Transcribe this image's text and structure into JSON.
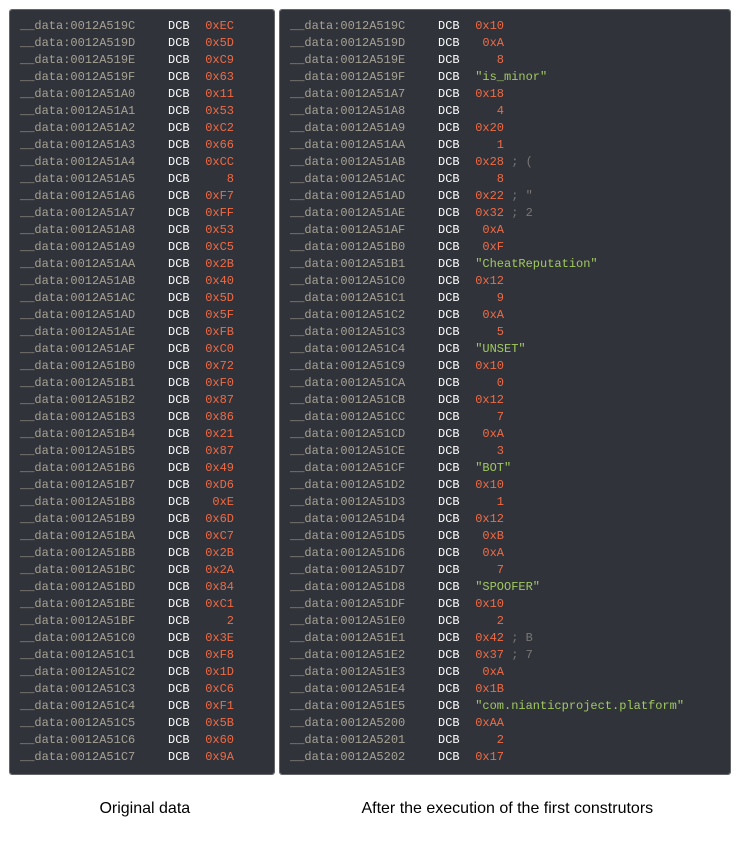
{
  "captions": {
    "left": "Original data",
    "right": "After the execution of the first construtors"
  },
  "dcb_keyword": "DCB",
  "prefix": "__data:",
  "left_rows": [
    {
      "a": "0012A519C",
      "v": "0xEC",
      "t": "hex"
    },
    {
      "a": "0012A519D",
      "v": "0x5D",
      "t": "hex"
    },
    {
      "a": "0012A519E",
      "v": "0xC9",
      "t": "hex"
    },
    {
      "a": "0012A519F",
      "v": "0x63",
      "t": "hex"
    },
    {
      "a": "0012A51A0",
      "v": "0x11",
      "t": "hex"
    },
    {
      "a": "0012A51A1",
      "v": "0x53",
      "t": "hex"
    },
    {
      "a": "0012A51A2",
      "v": "0xC2",
      "t": "hex"
    },
    {
      "a": "0012A51A3",
      "v": "0x66",
      "t": "hex"
    },
    {
      "a": "0012A51A4",
      "v": "0xCC",
      "t": "hex"
    },
    {
      "a": "0012A51A5",
      "v": "8",
      "t": "dec"
    },
    {
      "a": "0012A51A6",
      "v": "0xF7",
      "t": "hex"
    },
    {
      "a": "0012A51A7",
      "v": "0xFF",
      "t": "hex"
    },
    {
      "a": "0012A51A8",
      "v": "0x53",
      "t": "hex"
    },
    {
      "a": "0012A51A9",
      "v": "0xC5",
      "t": "hex"
    },
    {
      "a": "0012A51AA",
      "v": "0x2B",
      "t": "hex"
    },
    {
      "a": "0012A51AB",
      "v": "0x40",
      "t": "hex"
    },
    {
      "a": "0012A51AC",
      "v": "0x5D",
      "t": "hex"
    },
    {
      "a": "0012A51AD",
      "v": "0x5F",
      "t": "hex"
    },
    {
      "a": "0012A51AE",
      "v": "0xFB",
      "t": "hex"
    },
    {
      "a": "0012A51AF",
      "v": "0xC0",
      "t": "hex"
    },
    {
      "a": "0012A51B0",
      "v": "0x72",
      "t": "hex"
    },
    {
      "a": "0012A51B1",
      "v": "0xF0",
      "t": "hex"
    },
    {
      "a": "0012A51B2",
      "v": "0x87",
      "t": "hex"
    },
    {
      "a": "0012A51B3",
      "v": "0x86",
      "t": "hex"
    },
    {
      "a": "0012A51B4",
      "v": "0x21",
      "t": "hex"
    },
    {
      "a": "0012A51B5",
      "v": "0x87",
      "t": "hex"
    },
    {
      "a": "0012A51B6",
      "v": "0x49",
      "t": "hex"
    },
    {
      "a": "0012A51B7",
      "v": "0xD6",
      "t": "hex"
    },
    {
      "a": "0012A51B8",
      "v": "0xE",
      "t": "hex"
    },
    {
      "a": "0012A51B9",
      "v": "0x6D",
      "t": "hex"
    },
    {
      "a": "0012A51BA",
      "v": "0xC7",
      "t": "hex"
    },
    {
      "a": "0012A51BB",
      "v": "0x2B",
      "t": "hex"
    },
    {
      "a": "0012A51BC",
      "v": "0x2A",
      "t": "hex"
    },
    {
      "a": "0012A51BD",
      "v": "0x84",
      "t": "hex"
    },
    {
      "a": "0012A51BE",
      "v": "0xC1",
      "t": "hex"
    },
    {
      "a": "0012A51BF",
      "v": "2",
      "t": "dec"
    },
    {
      "a": "0012A51C0",
      "v": "0x3E",
      "t": "hex"
    },
    {
      "a": "0012A51C1",
      "v": "0xF8",
      "t": "hex"
    },
    {
      "a": "0012A51C2",
      "v": "0x1D",
      "t": "hex"
    },
    {
      "a": "0012A51C3",
      "v": "0xC6",
      "t": "hex"
    },
    {
      "a": "0012A51C4",
      "v": "0xF1",
      "t": "hex"
    },
    {
      "a": "0012A51C5",
      "v": "0x5B",
      "t": "hex"
    },
    {
      "a": "0012A51C6",
      "v": "0x60",
      "t": "hex"
    },
    {
      "a": "0012A51C7",
      "v": "0x9A",
      "t": "hex"
    }
  ],
  "right_rows": [
    {
      "a": "0012A519C",
      "v": "0x10",
      "t": "hex"
    },
    {
      "a": "0012A519D",
      "v": "0xA",
      "t": "hex"
    },
    {
      "a": "0012A519E",
      "v": "8",
      "t": "dec"
    },
    {
      "a": "0012A519F",
      "v": "\"is_minor\"",
      "t": "str"
    },
    {
      "a": "0012A51A7",
      "v": "0x18",
      "t": "hex"
    },
    {
      "a": "0012A51A8",
      "v": "4",
      "t": "dec"
    },
    {
      "a": "0012A51A9",
      "v": "0x20",
      "t": "hex"
    },
    {
      "a": "0012A51AA",
      "v": "1",
      "t": "dec"
    },
    {
      "a": "0012A51AB",
      "v": "0x28",
      "t": "hex",
      "c": "; ("
    },
    {
      "a": "0012A51AC",
      "v": "8",
      "t": "dec"
    },
    {
      "a": "0012A51AD",
      "v": "0x22",
      "t": "hex",
      "c": "; \""
    },
    {
      "a": "0012A51AE",
      "v": "0x32",
      "t": "hex",
      "c": "; 2"
    },
    {
      "a": "0012A51AF",
      "v": "0xA",
      "t": "hex"
    },
    {
      "a": "0012A51B0",
      "v": "0xF",
      "t": "hex"
    },
    {
      "a": "0012A51B1",
      "v": "\"CheatReputation\"",
      "t": "str"
    },
    {
      "a": "0012A51C0",
      "v": "0x12",
      "t": "hex"
    },
    {
      "a": "0012A51C1",
      "v": "9",
      "t": "dec"
    },
    {
      "a": "0012A51C2",
      "v": "0xA",
      "t": "hex"
    },
    {
      "a": "0012A51C3",
      "v": "5",
      "t": "dec"
    },
    {
      "a": "0012A51C4",
      "v": "\"UNSET\"",
      "t": "str"
    },
    {
      "a": "0012A51C9",
      "v": "0x10",
      "t": "hex"
    },
    {
      "a": "0012A51CA",
      "v": "0",
      "t": "dec"
    },
    {
      "a": "0012A51CB",
      "v": "0x12",
      "t": "hex"
    },
    {
      "a": "0012A51CC",
      "v": "7",
      "t": "dec"
    },
    {
      "a": "0012A51CD",
      "v": "0xA",
      "t": "hex"
    },
    {
      "a": "0012A51CE",
      "v": "3",
      "t": "dec"
    },
    {
      "a": "0012A51CF",
      "v": "\"BOT\"",
      "t": "str"
    },
    {
      "a": "0012A51D2",
      "v": "0x10",
      "t": "hex"
    },
    {
      "a": "0012A51D3",
      "v": "1",
      "t": "dec"
    },
    {
      "a": "0012A51D4",
      "v": "0x12",
      "t": "hex"
    },
    {
      "a": "0012A51D5",
      "v": "0xB",
      "t": "hex"
    },
    {
      "a": "0012A51D6",
      "v": "0xA",
      "t": "hex"
    },
    {
      "a": "0012A51D7",
      "v": "7",
      "t": "dec"
    },
    {
      "a": "0012A51D8",
      "v": "\"SPOOFER\"",
      "t": "str"
    },
    {
      "a": "0012A51DF",
      "v": "0x10",
      "t": "hex"
    },
    {
      "a": "0012A51E0",
      "v": "2",
      "t": "dec"
    },
    {
      "a": "0012A51E1",
      "v": "0x42",
      "t": "hex",
      "c": "; B"
    },
    {
      "a": "0012A51E2",
      "v": "0x37",
      "t": "hex",
      "c": "; 7"
    },
    {
      "a": "0012A51E3",
      "v": "0xA",
      "t": "hex"
    },
    {
      "a": "0012A51E4",
      "v": "0x1B",
      "t": "hex"
    },
    {
      "a": "0012A51E5",
      "v": "\"com.nianticproject.platform\"",
      "t": "str"
    },
    {
      "a": "0012A5200",
      "v": "0xAA",
      "t": "hex"
    },
    {
      "a": "0012A5201",
      "v": "2",
      "t": "dec"
    },
    {
      "a": "0012A5202",
      "v": "0x17",
      "t": "hex"
    }
  ]
}
